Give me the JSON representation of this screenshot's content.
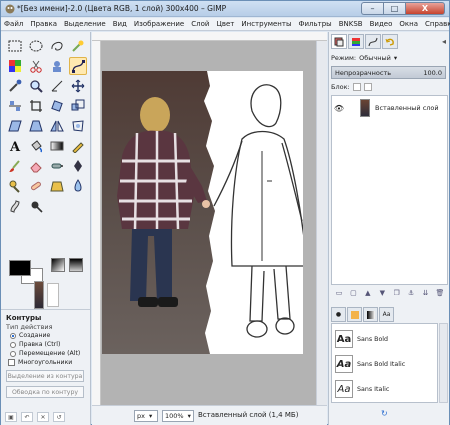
{
  "window": {
    "title": "*[Без имени]-2.0 (Цвета RGB, 1 слой) 300x400 – GIMP",
    "minimize": "–",
    "maximize": "□",
    "close": "X"
  },
  "menu": [
    "Файл",
    "Правка",
    "Выделение",
    "Вид",
    "Изображение",
    "Слой",
    "Цвет",
    "Инструменты",
    "Фильтры",
    "BNKSB",
    "Видео",
    "Окна",
    "Справка"
  ],
  "tool_options": {
    "title": "Контуры",
    "mode_label": "Тип действия",
    "modes": [
      "Создание",
      "Правка (Ctrl)",
      "Перемещение (Alt)"
    ],
    "selected_mode": "Создание",
    "polygonal_label": "Многоугольники",
    "selection_from_path": "Выделение из контура",
    "stroke_path": "Обводка по контуру"
  },
  "status": {
    "unit": "px",
    "zoom": "100%",
    "text": "Вставленный слой (1,4 МБ)"
  },
  "layers": {
    "mode_label": "Режим:",
    "mode_value": "Обычный",
    "opacity_label": "Непрозрачность",
    "opacity_value": "100.0",
    "lock_label": "Блок:",
    "items": [
      {
        "name": "Вставленный слой",
        "visible": true
      }
    ]
  },
  "fonts": {
    "preview": "Aa",
    "items": [
      "Sans Bold",
      "Sans Bold Italic",
      "Sans Italic"
    ]
  },
  "colors": {
    "accent": "#2d6fd1",
    "selection_highlight": "#ffe9b0",
    "canvas_gray": "#b3b3b3"
  }
}
